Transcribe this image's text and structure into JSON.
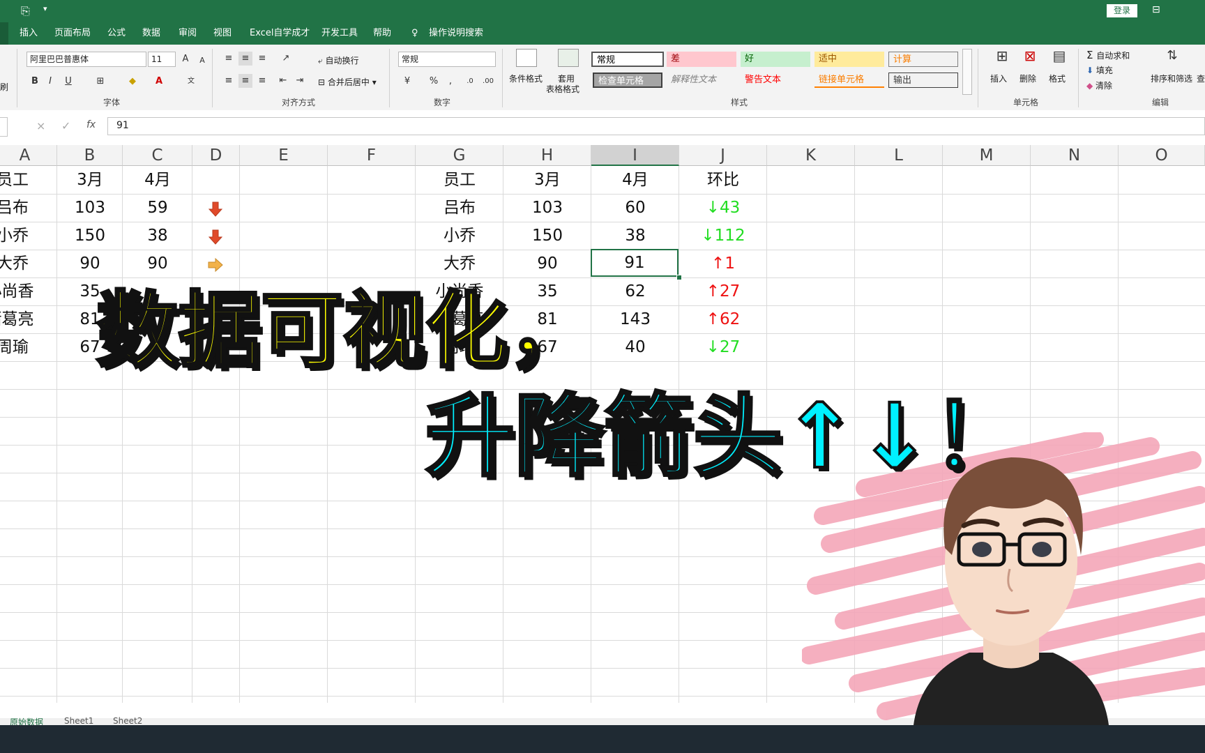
{
  "titlebar": {
    "login": "登录"
  },
  "menu": [
    "插入",
    "页面布局",
    "公式",
    "数据",
    "审阅",
    "视图",
    "Excel自学成才",
    "开发工具",
    "帮助",
    "操作说明搜索"
  ],
  "ribbon": {
    "font_name": "阿里巴巴普惠体",
    "font_size": "11",
    "bold": "B",
    "italic": "I",
    "underline": "U",
    "font_group": "字体",
    "wrap_text": "自动换行",
    "merge_center": "合并后居中",
    "align_group": "对齐方式",
    "number_format": "常规",
    "percent": "%",
    "comma": ",",
    "number_group": "数字",
    "cond_format": "条件格式",
    "table_format_1": "套用",
    "table_format_2": "表格格式",
    "styles": [
      "常规",
      "差",
      "好",
      "适中",
      "计算",
      "检查单元格",
      "解释性文本",
      "警告文本",
      "链接单元格",
      "输出"
    ],
    "styles_group": "样式",
    "insert": "插入",
    "delete": "删除",
    "format": "格式",
    "cells_group": "单元格",
    "autosum": "自动求和",
    "fill": "填充",
    "clear": "清除",
    "sort_filter": "排序和筛选",
    "find": "查",
    "edit_group": "编辑",
    "left_fragment": "刷"
  },
  "formula": {
    "cancel": "×",
    "enter": "✓",
    "fx": "fx",
    "value": "91"
  },
  "columns": [
    "A",
    "B",
    "C",
    "D",
    "E",
    "F",
    "G",
    "H",
    "I",
    "J",
    "K",
    "L",
    "M",
    "N",
    "O"
  ],
  "left_table": {
    "rows": [
      [
        "员工",
        "3月",
        "4月"
      ],
      [
        "吕布",
        "103",
        "59"
      ],
      [
        "小乔",
        "150",
        "38"
      ],
      [
        "大乔",
        "90",
        "90"
      ],
      [
        "小尚香",
        "35",
        ""
      ],
      [
        "诸葛亮",
        "81",
        ""
      ],
      [
        "周瑜",
        "67",
        ""
      ]
    ]
  },
  "right_table": {
    "rows": [
      [
        "员工",
        "3月",
        "4月",
        "环比"
      ],
      [
        "吕布",
        "103",
        "60",
        "↓43"
      ],
      [
        "小乔",
        "150",
        "38",
        "↓112"
      ],
      [
        "大乔",
        "90",
        "91",
        "↑1"
      ],
      [
        "小尚香",
        "35",
        "62",
        "↑27"
      ],
      [
        "诸葛亮",
        "81",
        "143",
        "↑62"
      ],
      [
        "周瑜",
        "67",
        "40",
        "↓27"
      ]
    ]
  },
  "sheet_tabs": [
    "原始数据",
    "Sheet1",
    "Sheet2"
  ],
  "overlay": {
    "line1": "数据可视化，",
    "line2": "升降箭头↑↓！"
  },
  "colors": {
    "excel_green": "#217346",
    "down": "#22dd22",
    "up": "#ee1111",
    "overlay_yellow": "#ffff00",
    "overlay_cyan": "#00f0ff"
  }
}
